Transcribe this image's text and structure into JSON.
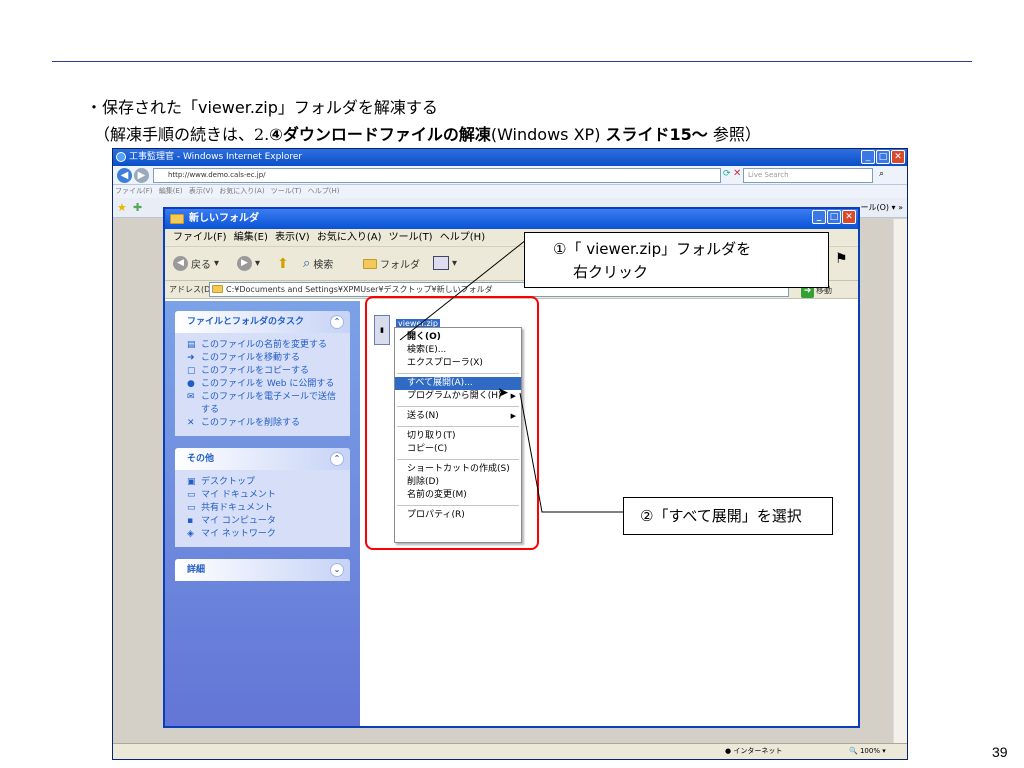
{
  "slide": {
    "bullet": "・保存された「",
    "zip_name": "viewer.zip",
    "bullet_tail": "」フォルダを解凍する",
    "note_open": "（解凍手順の続きは、2.",
    "note_bold": "④ダウンロードファイルの解凍",
    "note_mid": "(Windows XP) ",
    "note_bold2": "スライド15〜",
    "note_close": " 参照）",
    "page_number": "39"
  },
  "ie": {
    "title": "工事監理官 - Windows Internet Explorer",
    "address": "http://www.demo.cals-ec.jp/",
    "search_placeholder": "Live Search",
    "menu": "ファイル(F)  編集(E)  表示(V)  お気に入り(A)  ツール(T)  ヘルプ(H)",
    "fav_more": "ール(O) ▾ »",
    "status_zone": "インターネット",
    "status_zoom": "100%"
  },
  "explorer": {
    "title": "新しいフォルダ",
    "menu": "ファイル(F)  編集(E)  表示(V)  お気に入り(A)  ツール(T)  ヘルプ(H)",
    "tb_back": "戻る",
    "tb_search": "検索",
    "tb_folder": "フォルダ",
    "address_label": "アドレス(D)",
    "address_value": "C:¥Documents and Settings¥XPMUser¥デスクトップ¥新しいフォルダ",
    "go_label": "移動",
    "file_tasks_header": "ファイルとフォルダのタスク",
    "file_tasks": [
      {
        "icon": "rename-icon",
        "glyph": "▤",
        "label": "このファイルの名前を変更する"
      },
      {
        "icon": "move-icon",
        "glyph": "➜",
        "label": "このファイルを移動する"
      },
      {
        "icon": "copy-icon",
        "glyph": "▢",
        "label": "このファイルをコピーする"
      },
      {
        "icon": "web-publish-icon",
        "glyph": "●",
        "label": "このファイルを Web に公開する"
      },
      {
        "icon": "email-icon",
        "glyph": "✉",
        "label": "このファイルを電子メールで送信する"
      },
      {
        "icon": "delete-icon",
        "glyph": "✕",
        "label": "このファイルを削除する"
      }
    ],
    "other_header": "その他",
    "other_items": [
      {
        "icon": "desktop-icon",
        "glyph": "▣",
        "label": "デスクトップ"
      },
      {
        "icon": "my-documents-icon",
        "glyph": "▭",
        "label": "マイ ドキュメント"
      },
      {
        "icon": "shared-documents-icon",
        "glyph": "▭",
        "label": "共有ドキュメント"
      },
      {
        "icon": "my-computer-icon",
        "glyph": "▪",
        "label": "マイ コンピュータ"
      },
      {
        "icon": "my-network-icon",
        "glyph": "◈",
        "label": "マイ ネットワーク"
      }
    ],
    "details_header": "詳細",
    "file_label": "viewer.zip"
  },
  "context_menu": {
    "open": "開く(O)",
    "search": "検索(E)...",
    "explore": "エクスプローラ(X)",
    "extract_all": "すべて展開(A)...",
    "open_with": "プログラムから開く(H)",
    "send_to": "送る(N)",
    "cut": "切り取り(T)",
    "copy": "コピー(C)",
    "create_shortcut": "ショートカットの作成(S)",
    "delete": "削除(D)",
    "rename": "名前の変更(M)",
    "properties": "プロパティ(R)"
  },
  "callouts": {
    "step1_line1": "①「 viewer.zip」フォルダを",
    "step1_line2": "右クリック",
    "step2": "②「すべて展開」を選択"
  },
  "colors": {
    "accent_line": "#2b3f8c",
    "highlight_box": "#ff0000",
    "xp_title_blue": "#0a53d6",
    "menu_selection": "#316ac5"
  }
}
